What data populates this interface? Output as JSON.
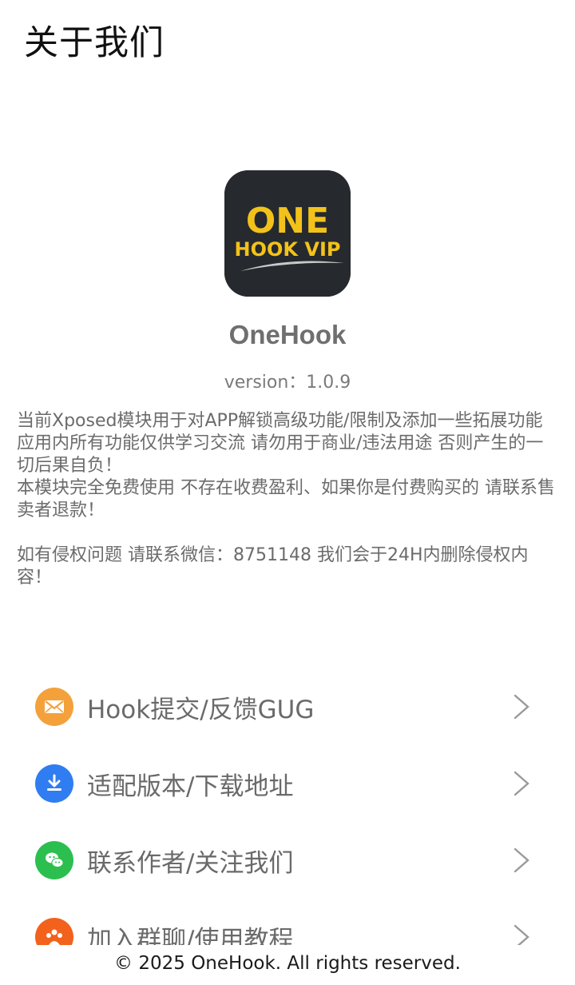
{
  "page": {
    "title": "关于我们"
  },
  "app": {
    "logo_line1": "ONE",
    "logo_line2": "HOOK VIP",
    "name": "OneHook",
    "version": "version：1.0.9"
  },
  "description": {
    "line1": "当前Xposed模块用于对APP解锁高级功能/限制及添加一些拓展功能",
    "line2": "应用内所有功能仅供学习交流 请勿用于商业/违法用途 否则产生的一切后果自负！",
    "line3": "本模块完全免费使用 不存在收费盈利、如果你是付费购买的 请联系售卖者退款！",
    "line4": "如有侵权问题 请联系微信：8751148  我们会于24H内删除侵权内容！"
  },
  "menu": {
    "items": [
      {
        "label": "Hook提交/反馈GUG",
        "icon": "mail-icon",
        "color": "#f4a13b"
      },
      {
        "label": "适配版本/下载地址",
        "icon": "download-icon",
        "color": "#2f7df1"
      },
      {
        "label": "联系作者/关注我们",
        "icon": "wechat-icon",
        "color": "#2cbf4f"
      },
      {
        "label": "加入群聊/使用教程",
        "icon": "group-icon",
        "color": "#f2621c"
      }
    ]
  },
  "footer": {
    "text": "© 2025 OneHook. All rights reserved."
  }
}
